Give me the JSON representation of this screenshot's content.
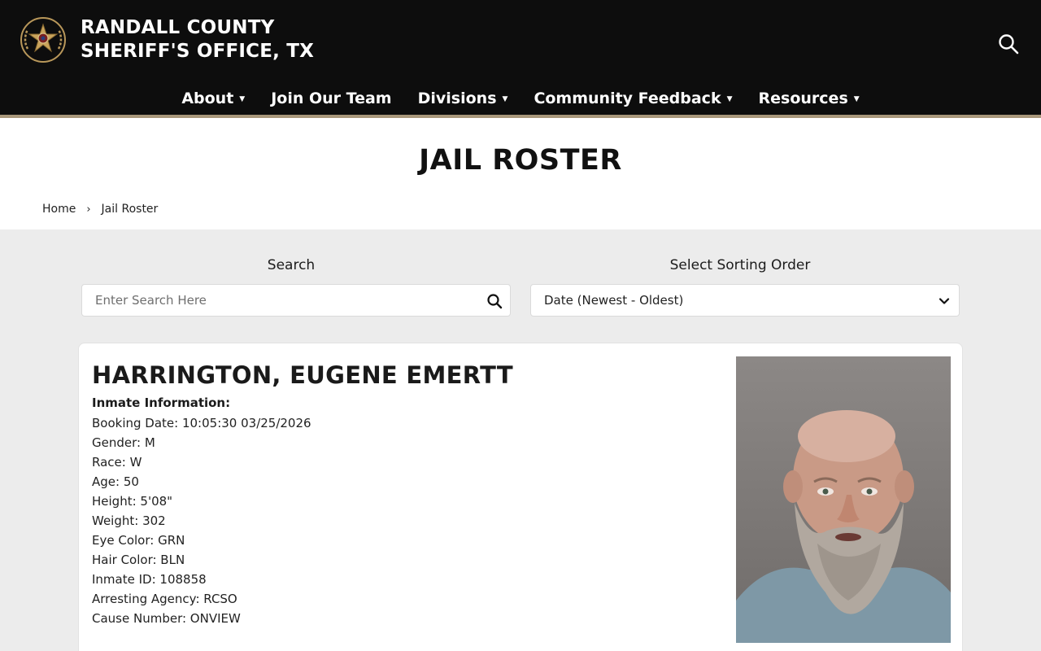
{
  "header": {
    "title_line1": "RANDALL COUNTY",
    "title_line2": "SHERIFF'S OFFICE, TX",
    "logo_icon": "sheriff-star-badge-icon",
    "search_icon": "search-icon"
  },
  "nav": {
    "items": [
      {
        "label": "About",
        "has_dropdown": true
      },
      {
        "label": "Join Our Team",
        "has_dropdown": false
      },
      {
        "label": "Divisions",
        "has_dropdown": true
      },
      {
        "label": "Community Feedback",
        "has_dropdown": true
      },
      {
        "label": "Resources",
        "has_dropdown": true
      }
    ],
    "caret": "▼"
  },
  "page": {
    "title": "JAIL ROSTER"
  },
  "breadcrumb": {
    "home": "Home",
    "separator": "›",
    "current": "Jail Roster"
  },
  "search": {
    "label": "Search",
    "placeholder": "Enter Search Here"
  },
  "sort": {
    "label": "Select Sorting Order",
    "selected": "Date (Newest - Oldest)"
  },
  "inmate": {
    "name": "HARRINGTON, EUGENE EMERTT",
    "section_heading": "Inmate Information:",
    "fields": [
      "Booking Date: 10:05:30 03/25/2026",
      "Gender: M",
      "Race: W",
      "Age: 50",
      "Height: 5'08\"",
      "Weight: 302",
      "Eye Color: GRN",
      "Hair Color: BLN",
      "Inmate ID: 108858",
      "Arresting Agency: RCSO",
      "Cause Number: ONVIEW"
    ]
  },
  "colors": {
    "header_bg": "#0d0d0d",
    "accent_gold": "#a8977a",
    "page_bg": "#ececec",
    "card_bg": "#ffffff"
  }
}
